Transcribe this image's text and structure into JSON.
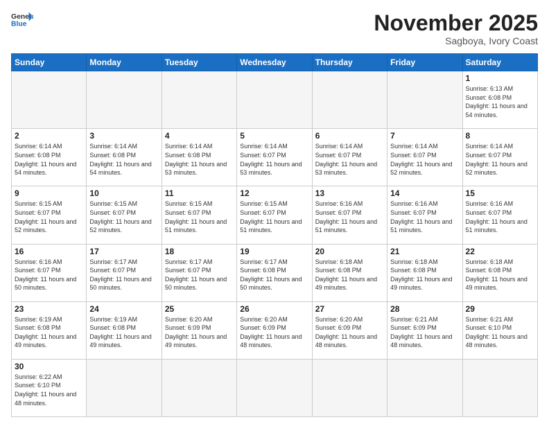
{
  "header": {
    "logo_general": "General",
    "logo_blue": "Blue",
    "month_title": "November 2025",
    "location": "Sagboya, Ivory Coast"
  },
  "days_of_week": [
    "Sunday",
    "Monday",
    "Tuesday",
    "Wednesday",
    "Thursday",
    "Friday",
    "Saturday"
  ],
  "weeks": [
    [
      {
        "day": "",
        "info": ""
      },
      {
        "day": "",
        "info": ""
      },
      {
        "day": "",
        "info": ""
      },
      {
        "day": "",
        "info": ""
      },
      {
        "day": "",
        "info": ""
      },
      {
        "day": "",
        "info": ""
      },
      {
        "day": "1",
        "info": "Sunrise: 6:13 AM\nSunset: 6:08 PM\nDaylight: 11 hours and 54 minutes."
      }
    ],
    [
      {
        "day": "2",
        "info": "Sunrise: 6:14 AM\nSunset: 6:08 PM\nDaylight: 11 hours and 54 minutes."
      },
      {
        "day": "3",
        "info": "Sunrise: 6:14 AM\nSunset: 6:08 PM\nDaylight: 11 hours and 54 minutes."
      },
      {
        "day": "4",
        "info": "Sunrise: 6:14 AM\nSunset: 6:08 PM\nDaylight: 11 hours and 53 minutes."
      },
      {
        "day": "5",
        "info": "Sunrise: 6:14 AM\nSunset: 6:07 PM\nDaylight: 11 hours and 53 minutes."
      },
      {
        "day": "6",
        "info": "Sunrise: 6:14 AM\nSunset: 6:07 PM\nDaylight: 11 hours and 53 minutes."
      },
      {
        "day": "7",
        "info": "Sunrise: 6:14 AM\nSunset: 6:07 PM\nDaylight: 11 hours and 52 minutes."
      },
      {
        "day": "8",
        "info": "Sunrise: 6:14 AM\nSunset: 6:07 PM\nDaylight: 11 hours and 52 minutes."
      }
    ],
    [
      {
        "day": "9",
        "info": "Sunrise: 6:15 AM\nSunset: 6:07 PM\nDaylight: 11 hours and 52 minutes."
      },
      {
        "day": "10",
        "info": "Sunrise: 6:15 AM\nSunset: 6:07 PM\nDaylight: 11 hours and 52 minutes."
      },
      {
        "day": "11",
        "info": "Sunrise: 6:15 AM\nSunset: 6:07 PM\nDaylight: 11 hours and 51 minutes."
      },
      {
        "day": "12",
        "info": "Sunrise: 6:15 AM\nSunset: 6:07 PM\nDaylight: 11 hours and 51 minutes."
      },
      {
        "day": "13",
        "info": "Sunrise: 6:16 AM\nSunset: 6:07 PM\nDaylight: 11 hours and 51 minutes."
      },
      {
        "day": "14",
        "info": "Sunrise: 6:16 AM\nSunset: 6:07 PM\nDaylight: 11 hours and 51 minutes."
      },
      {
        "day": "15",
        "info": "Sunrise: 6:16 AM\nSunset: 6:07 PM\nDaylight: 11 hours and 51 minutes."
      }
    ],
    [
      {
        "day": "16",
        "info": "Sunrise: 6:16 AM\nSunset: 6:07 PM\nDaylight: 11 hours and 50 minutes."
      },
      {
        "day": "17",
        "info": "Sunrise: 6:17 AM\nSunset: 6:07 PM\nDaylight: 11 hours and 50 minutes."
      },
      {
        "day": "18",
        "info": "Sunrise: 6:17 AM\nSunset: 6:07 PM\nDaylight: 11 hours and 50 minutes."
      },
      {
        "day": "19",
        "info": "Sunrise: 6:17 AM\nSunset: 6:08 PM\nDaylight: 11 hours and 50 minutes."
      },
      {
        "day": "20",
        "info": "Sunrise: 6:18 AM\nSunset: 6:08 PM\nDaylight: 11 hours and 49 minutes."
      },
      {
        "day": "21",
        "info": "Sunrise: 6:18 AM\nSunset: 6:08 PM\nDaylight: 11 hours and 49 minutes."
      },
      {
        "day": "22",
        "info": "Sunrise: 6:18 AM\nSunset: 6:08 PM\nDaylight: 11 hours and 49 minutes."
      }
    ],
    [
      {
        "day": "23",
        "info": "Sunrise: 6:19 AM\nSunset: 6:08 PM\nDaylight: 11 hours and 49 minutes."
      },
      {
        "day": "24",
        "info": "Sunrise: 6:19 AM\nSunset: 6:08 PM\nDaylight: 11 hours and 49 minutes."
      },
      {
        "day": "25",
        "info": "Sunrise: 6:20 AM\nSunset: 6:09 PM\nDaylight: 11 hours and 49 minutes."
      },
      {
        "day": "26",
        "info": "Sunrise: 6:20 AM\nSunset: 6:09 PM\nDaylight: 11 hours and 48 minutes."
      },
      {
        "day": "27",
        "info": "Sunrise: 6:20 AM\nSunset: 6:09 PM\nDaylight: 11 hours and 48 minutes."
      },
      {
        "day": "28",
        "info": "Sunrise: 6:21 AM\nSunset: 6:09 PM\nDaylight: 11 hours and 48 minutes."
      },
      {
        "day": "29",
        "info": "Sunrise: 6:21 AM\nSunset: 6:10 PM\nDaylight: 11 hours and 48 minutes."
      }
    ],
    [
      {
        "day": "30",
        "info": "Sunrise: 6:22 AM\nSunset: 6:10 PM\nDaylight: 11 hours and 48 minutes."
      },
      {
        "day": "",
        "info": ""
      },
      {
        "day": "",
        "info": ""
      },
      {
        "day": "",
        "info": ""
      },
      {
        "day": "",
        "info": ""
      },
      {
        "day": "",
        "info": ""
      },
      {
        "day": "",
        "info": ""
      }
    ]
  ]
}
